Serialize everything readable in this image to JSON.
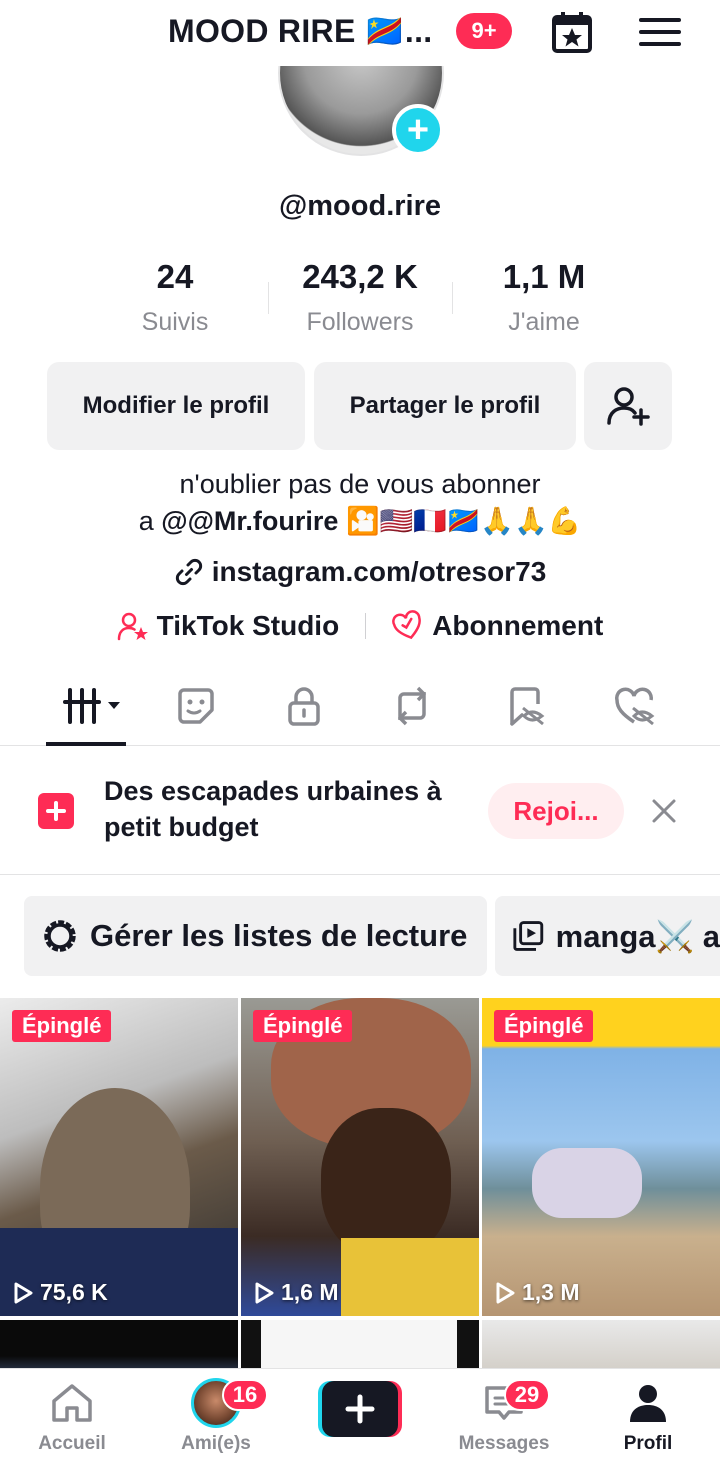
{
  "header": {
    "title": "MOOD RIRE 🇨🇩...",
    "notif_count": "9+"
  },
  "profile": {
    "username": "@mood.rire",
    "stats": [
      {
        "value": "24",
        "label": "Suivis"
      },
      {
        "value": "243,2 K",
        "label": "Followers"
      },
      {
        "value": "1,1 M",
        "label": "J'aime"
      }
    ],
    "edit_label": "Modifier le profil",
    "share_label": "Partager le profil",
    "bio_line1": "n'oublier pas de vous abonner",
    "bio_line2_prefix": "a ",
    "bio_line2_mention": "@@Mr.fourire",
    "bio_line2_emojis": " 🎦🇺🇸🇫🇷🇨🇩🙏🙏💪",
    "link": "instagram.com/otresor73",
    "studio_label": "TikTok Studio",
    "subscription_label": "Abonnement"
  },
  "tabs": [
    "videos-grid",
    "favorites",
    "private",
    "reposts",
    "liked-hidden",
    "favorites-hidden"
  ],
  "promo": {
    "text": "Des escapades urbaines à petit budget",
    "join_label": "Rejoi..."
  },
  "playlists": {
    "manage_label": "Gérer les listes de lecture",
    "playlist1": "manga⚔️ a"
  },
  "videos": [
    {
      "pinned": "Épinglé",
      "views": "75,6 K"
    },
    {
      "pinned": "Épinglé",
      "views": "1,6 M"
    },
    {
      "pinned": "Épinglé",
      "views": "1,3 M"
    }
  ],
  "nav": {
    "home": "Accueil",
    "friends": "Ami(e)s",
    "friends_badge": "16",
    "messages": "Messages",
    "messages_badge": "29",
    "profile": "Profil"
  },
  "colors": {
    "accent": "#fe2c55",
    "cyan": "#20d5ec",
    "text": "#161823",
    "muted": "#8a8b91"
  }
}
